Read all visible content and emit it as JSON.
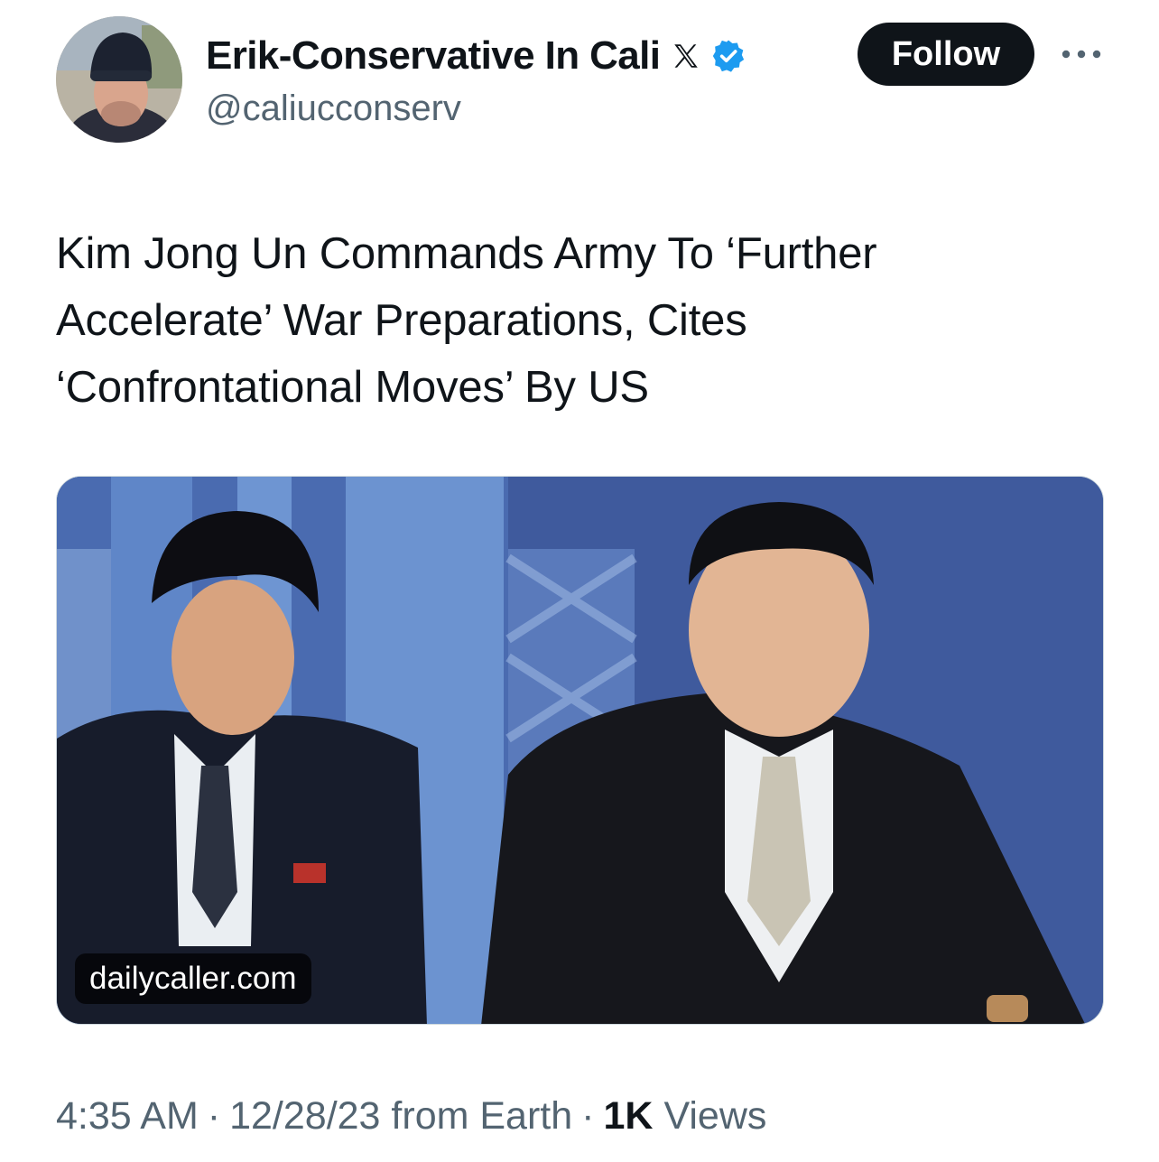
{
  "author": {
    "display_name": "Erik-Conservative In Cali",
    "handle": "@caliucconserv",
    "badge_icon": "x-logo-icon",
    "verified_icon": "verified-badge-icon",
    "verified_color": "#1d9bf0"
  },
  "actions": {
    "follow_label": "Follow",
    "more_icon": "more-dots-icon"
  },
  "tweet": {
    "text_lines": [
      "Kim Jong Un Commands Army To ‘Further",
      "Accelerate’ War Preparations, Cites",
      "‘Confrontational Moves’ By US"
    ]
  },
  "card": {
    "domain": "dailycaller.com"
  },
  "meta": {
    "time": "4:35 AM",
    "separator": "·",
    "date_source": "12/28/23 from Earth",
    "views_count": "1K",
    "views_label": "Views"
  },
  "colors": {
    "text_primary": "#0f1419",
    "text_secondary": "#536471",
    "follow_bg": "#0f1419",
    "media_bg": "#3e5a9e"
  }
}
